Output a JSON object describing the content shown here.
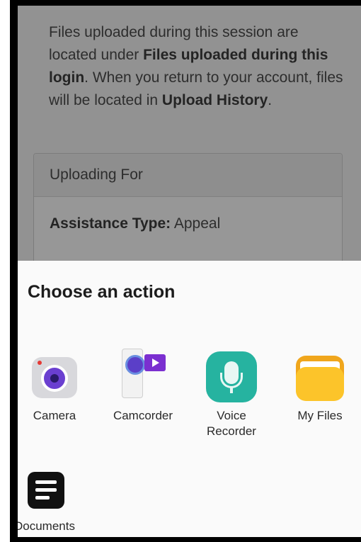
{
  "background": {
    "intro_1": "Files uploaded during this session are located under ",
    "intro_bold_1": "Files uploaded during this login",
    "intro_2": ". When you return to your account, files will be located in ",
    "intro_bold_2": "Upload History",
    "intro_3": ".",
    "panel_header": "Uploading For",
    "assistance_label": "Assistance Type:",
    "assistance_value": " Appeal"
  },
  "sheet": {
    "title": "Choose an action",
    "apps": [
      {
        "label": "Camera",
        "icon": "camera-icon"
      },
      {
        "label": "Camcorder",
        "icon": "camcorder-icon"
      },
      {
        "label": "Voice\nRecorder",
        "icon": "voice-recorder-icon"
      },
      {
        "label": "My Files",
        "icon": "folder-icon"
      },
      {
        "label": "Documents",
        "icon": "documents-icon"
      }
    ]
  },
  "colors": {
    "dim_overlay": "#00000061",
    "voice_recorder": "#26b3a0",
    "my_files": "#fcc42a",
    "camcorder_screen": "#7b2fd0"
  }
}
